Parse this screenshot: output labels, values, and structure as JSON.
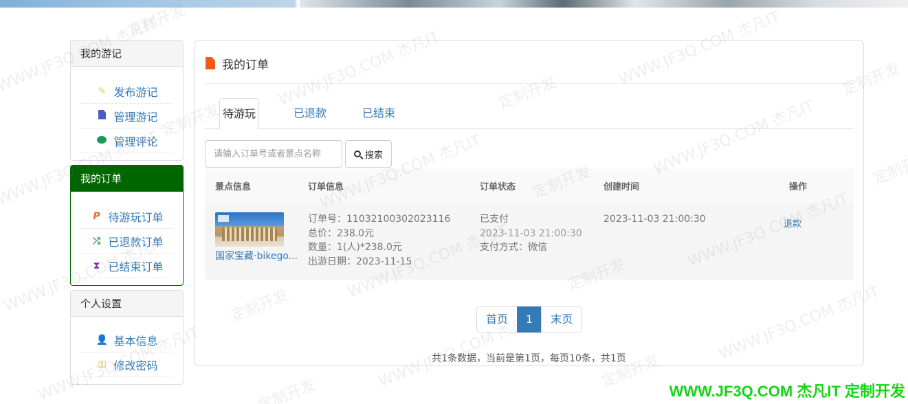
{
  "sidebar": {
    "sections": [
      {
        "title": "我的游记",
        "items": [
          {
            "label": "发布游记",
            "icon": "edit-icon"
          },
          {
            "label": "管理游记",
            "icon": "document-icon"
          },
          {
            "label": "管理评论",
            "icon": "comment-icon"
          }
        ]
      },
      {
        "title": "我的订单",
        "items": [
          {
            "label": "待游玩订单",
            "icon": "paypal-icon"
          },
          {
            "label": "已退款订单",
            "icon": "shuffle-icon"
          },
          {
            "label": "已结束订单",
            "icon": "hourglass-icon"
          }
        ]
      },
      {
        "title": "个人设置",
        "items": [
          {
            "label": "基本信息",
            "icon": "user-icon"
          },
          {
            "label": "修改密码",
            "icon": "key-icon"
          }
        ]
      }
    ]
  },
  "main": {
    "title": "我的订单",
    "tabs": [
      "待游玩",
      "已退款",
      "已结束"
    ],
    "search": {
      "placeholder": "请输入订单号或者景点名称",
      "button_label": "搜索"
    },
    "table": {
      "headers": [
        "景点信息",
        "订单信息",
        "订单状态",
        "创建时间",
        "操作"
      ],
      "rows": [
        {
          "spot_name": "国家宝藏·bikego...",
          "order_no": "订单号：11032100302023116",
          "total": "总价：238.0元",
          "quantity": "数量：1(人)*238.0元",
          "travel_date": "出游日期：2023-11-15",
          "status": "已支付",
          "paid_time": "2023-11-03 21:00:30",
          "pay_method": "支付方式：微信",
          "created": "2023-11-03 21:00:30",
          "action": "退款"
        }
      ]
    },
    "pager": {
      "first": "首页",
      "current": "1",
      "last": "末页",
      "summary": "共1条数据，当前是第1页，每页10条，共1页"
    }
  },
  "watermark": {
    "text_a": "WWW.JF3Q.COM 杰凡IT",
    "text_b": "定制开发",
    "brand": "WWW.JF3Q.COM 杰凡IT  定制开发"
  },
  "colors": {
    "active_section": "#006600",
    "link": "#337ab7",
    "title_icon": "#f05a1a",
    "brand_green": "#16d416"
  }
}
